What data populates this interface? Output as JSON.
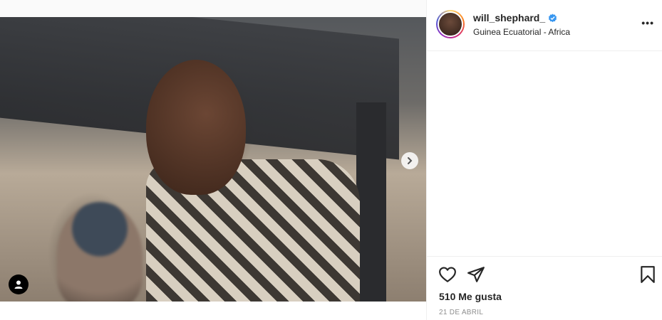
{
  "post": {
    "username": "will_shephard_",
    "location": "Guinea Ecuatorial - Africa",
    "likes": "510 Me gusta",
    "date": "21 DE ABRIL",
    "more_label": "•••",
    "icons": {
      "verified": "verified-badge-icon",
      "like": "heart-icon",
      "share": "paper-plane-icon",
      "save": "bookmark-icon",
      "next": "chevron-right-icon",
      "tag": "user-tag-icon"
    },
    "colors": {
      "verified": "#3897f0",
      "text": "#262626",
      "muted": "#8e8e8e"
    }
  }
}
